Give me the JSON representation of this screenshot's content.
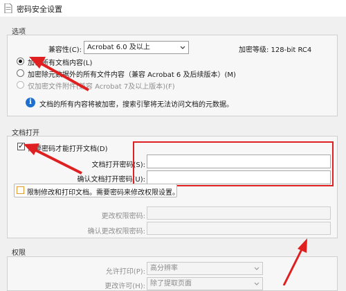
{
  "window": {
    "title": "密码安全设置"
  },
  "options": {
    "section": "选项",
    "compat_label": "兼容性(C):",
    "compat_value": "Acrobat 6.0 及以上",
    "encryption_level": "加密等级: 128-bit RC4",
    "radios": [
      {
        "label": "加密所有文档内容(L)",
        "selected": true
      },
      {
        "label": "加密除元数据外的所有文件内容（兼容 Acrobat 6 及后续版本）(M)",
        "selected": false
      },
      {
        "label": "仅加密文件附件(兼容 Acrobat 7及以上版本)(F)",
        "selected": false,
        "disabled": true
      }
    ],
    "info": "文档的所有内容将被加密，搜索引擎将无法访问文档的元数据。"
  },
  "open_password": {
    "section": "文档打开",
    "require_label": "需要密码才能打开文档(D)",
    "require_checked": true,
    "pwd_label": "文档打开密码(S):",
    "confirm_label": "确认文档打开密码(U):"
  },
  "permissions_password": {
    "restrict_label": "限制修改和打印文档。需要密码来修改权限设置。",
    "restrict_checked": false,
    "change_label": "更改权限密码:",
    "confirm_label": "确认更改权限密码:"
  },
  "permissions": {
    "section": "权限",
    "print_label": "允许打印(P):",
    "print_value": "高分辨率",
    "change_label": "更改许可(H):",
    "change_value": "除了提取页面"
  },
  "colors": {
    "annotation_red": "#e02020",
    "info_blue": "#1f6fd1"
  }
}
